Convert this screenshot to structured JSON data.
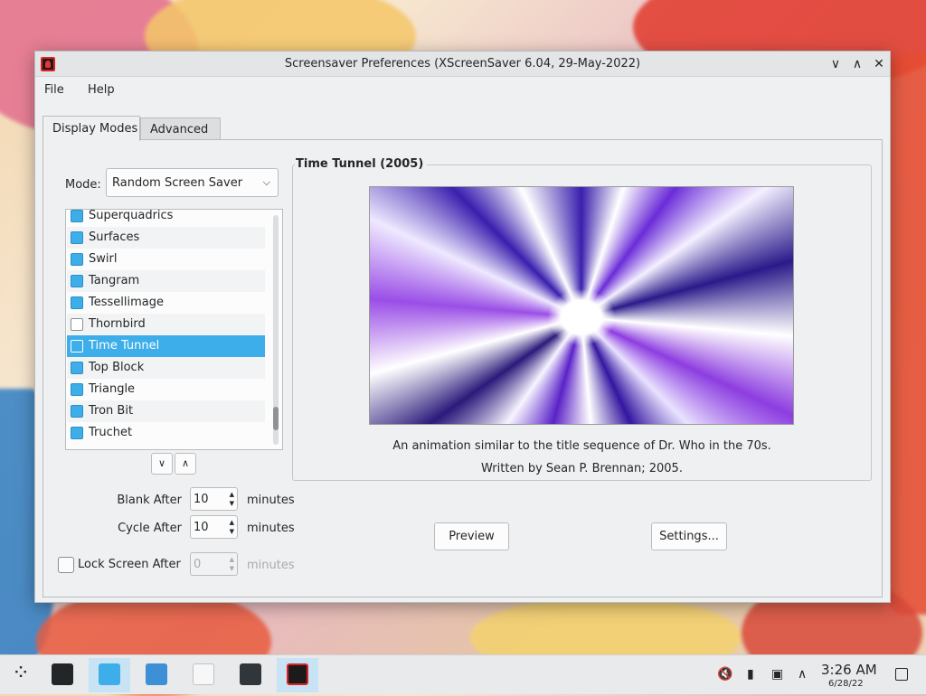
{
  "window": {
    "title": "Screensaver Preferences (XScreenSaver 6.04, 29-May-2022)",
    "controls": {
      "minimize": "∨",
      "maximize": "∧",
      "close": "✕"
    }
  },
  "menu": {
    "file": "File",
    "help": "Help"
  },
  "tabs": [
    {
      "label": "Display Modes",
      "active": true
    },
    {
      "label": "Advanced",
      "active": false
    }
  ],
  "mode": {
    "label": "Mode:",
    "value": "Random Screen Saver"
  },
  "savers": [
    {
      "name": "Superquadrics",
      "checked": true
    },
    {
      "name": "Surfaces",
      "checked": true
    },
    {
      "name": "Swirl",
      "checked": true
    },
    {
      "name": "Tangram",
      "checked": true
    },
    {
      "name": "Tessellimage",
      "checked": true
    },
    {
      "name": "Thornbird",
      "checked": false
    },
    {
      "name": "Time Tunnel",
      "checked": true,
      "selected": true
    },
    {
      "name": "Top Block",
      "checked": true
    },
    {
      "name": "Triangle",
      "checked": true
    },
    {
      "name": "Tron Bit",
      "checked": true
    },
    {
      "name": "Truchet",
      "checked": true
    }
  ],
  "blank_after": {
    "label": "Blank After",
    "value": "10",
    "unit": "minutes"
  },
  "cycle_after": {
    "label": "Cycle After",
    "value": "10",
    "unit": "minutes"
  },
  "lock": {
    "label": "Lock Screen After",
    "value": "0",
    "unit": "minutes",
    "checked": false
  },
  "preview_group": {
    "title": "Time Tunnel (2005)",
    "description": "An animation similar to the title sequence of Dr. Who in the 70s.",
    "credit": "Written by Sean P. Brennan; 2005."
  },
  "buttons": {
    "preview": "Preview",
    "settings": "Settings..."
  },
  "taskbar": {
    "apps": [
      {
        "name": "launcher",
        "icon": "launcher-icon"
      },
      {
        "name": "system-settings",
        "icon": "settings-icon"
      },
      {
        "name": "discover",
        "icon": "store-icon",
        "active": true
      },
      {
        "name": "dolphin",
        "icon": "folder-icon"
      },
      {
        "name": "text-editor",
        "icon": "text-editor-icon"
      },
      {
        "name": "terminal",
        "icon": "terminal-icon"
      },
      {
        "name": "xscreensaver",
        "icon": "xscreensaver-icon",
        "active": true
      }
    ],
    "tray": [
      "volume-muted-icon",
      "usb-icon",
      "network-icon",
      "chevron-up-icon"
    ],
    "time": "3:26 AM",
    "date": "6/28/22"
  },
  "colors": {
    "accent": "#3daee9",
    "window_bg": "#eff0f1"
  }
}
